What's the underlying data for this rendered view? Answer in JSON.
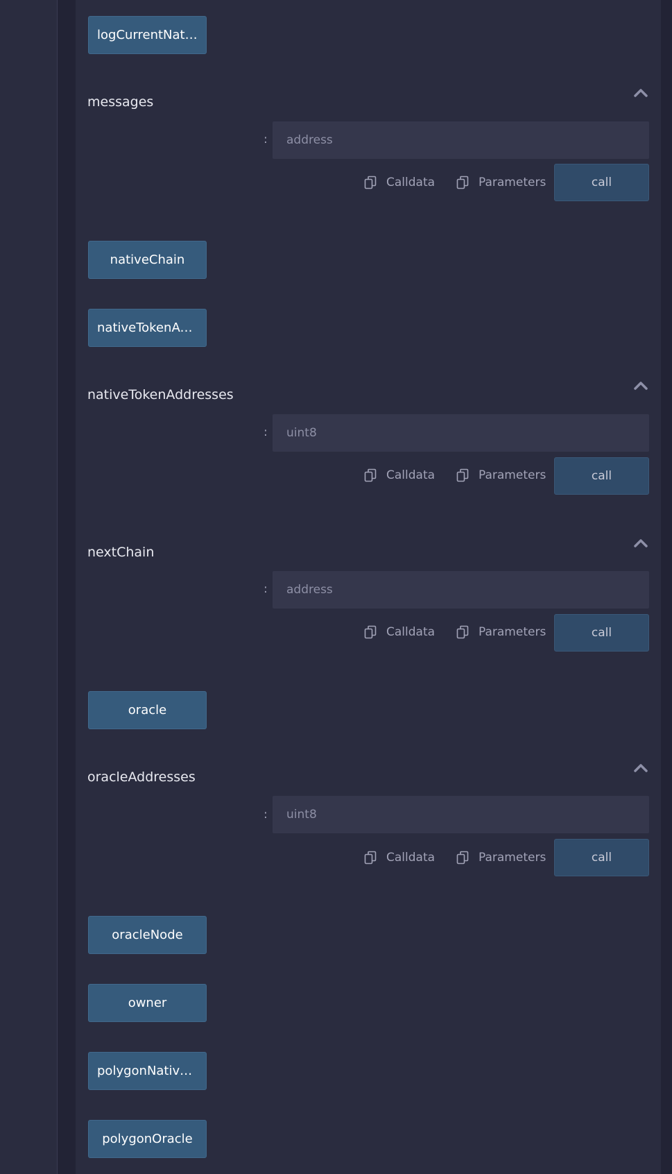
{
  "functions": [
    {
      "type": "button",
      "label": "logCurrentNati…"
    },
    {
      "type": "query",
      "title": "messages",
      "placeholder": "address",
      "colon": ":",
      "calldata_label": "Calldata",
      "parameters_label": "Parameters",
      "call_label": "call"
    },
    {
      "type": "button",
      "label": "nativeChain"
    },
    {
      "type": "button",
      "label": "nativeTokenAd…"
    },
    {
      "type": "query",
      "title": "nativeTokenAddresses",
      "placeholder": "uint8",
      "colon": ":",
      "calldata_label": "Calldata",
      "parameters_label": "Parameters",
      "call_label": "call"
    },
    {
      "type": "query",
      "title": "nextChain",
      "placeholder": "address",
      "colon": ":",
      "calldata_label": "Calldata",
      "parameters_label": "Parameters",
      "call_label": "call"
    },
    {
      "type": "button",
      "label": "oracle"
    },
    {
      "type": "query",
      "title": "oracleAddresses",
      "placeholder": "uint8",
      "colon": ":",
      "calldata_label": "Calldata",
      "parameters_label": "Parameters",
      "call_label": "call"
    },
    {
      "type": "button",
      "label": "oracleNode"
    },
    {
      "type": "button",
      "label": "owner"
    },
    {
      "type": "button",
      "label": "polygonNative…"
    },
    {
      "type": "button",
      "label": "polygonOracle"
    }
  ],
  "icons": {
    "collapse": "chevron-up-icon",
    "copy": "copy-icon"
  },
  "colors": {
    "background": "#222335",
    "panel": "#2a2c3f",
    "function_button": "#365b7c",
    "call_button": "#304b69",
    "input": "#35374c"
  }
}
